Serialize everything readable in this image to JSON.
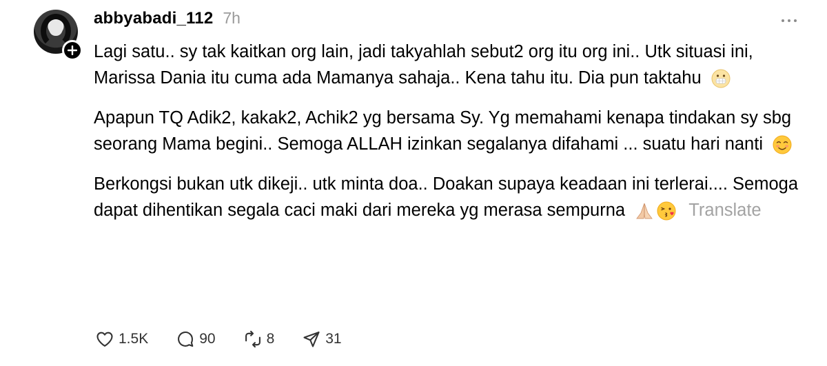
{
  "post": {
    "username": "abbyabadi_112",
    "time": "7h",
    "paragraphs": [
      "Lagi satu.. sy tak kaitkan org lain, jadi takyahlah sebut2 org itu org ini.. Utk situasi ini, Marissa Dania itu cuma ada Mamanya sahaja.. Kena tahu itu. Dia pun taktahu",
      "Apapun TQ Adik2, kakak2, Achik2 yg bersama Sy. Yg memahami kenapa tindakan sy sbg seorang Mama begini.. Semoga ALLAH izinkan segalanya difahami ... suatu hari nanti",
      "Berkongsi bukan utk dikeji.. utk minta doa.. Doakan supaya keadaan ini terlerai.... Semoga dapat dihentikan segala caci maki dari mereka yg merasa sempurna"
    ],
    "translate_label": "Translate",
    "emojis": [
      "grimace-mask-emoji",
      "smiling-blush-emoji",
      "folded-hands-emoji",
      "kiss-emoji"
    ]
  },
  "actions": {
    "likes": "1.5K",
    "replies": "90",
    "reposts": "8",
    "shares": "31"
  },
  "colors": {
    "text": "#000000",
    "muted": "#9a9a9a",
    "icon": "#333333"
  }
}
